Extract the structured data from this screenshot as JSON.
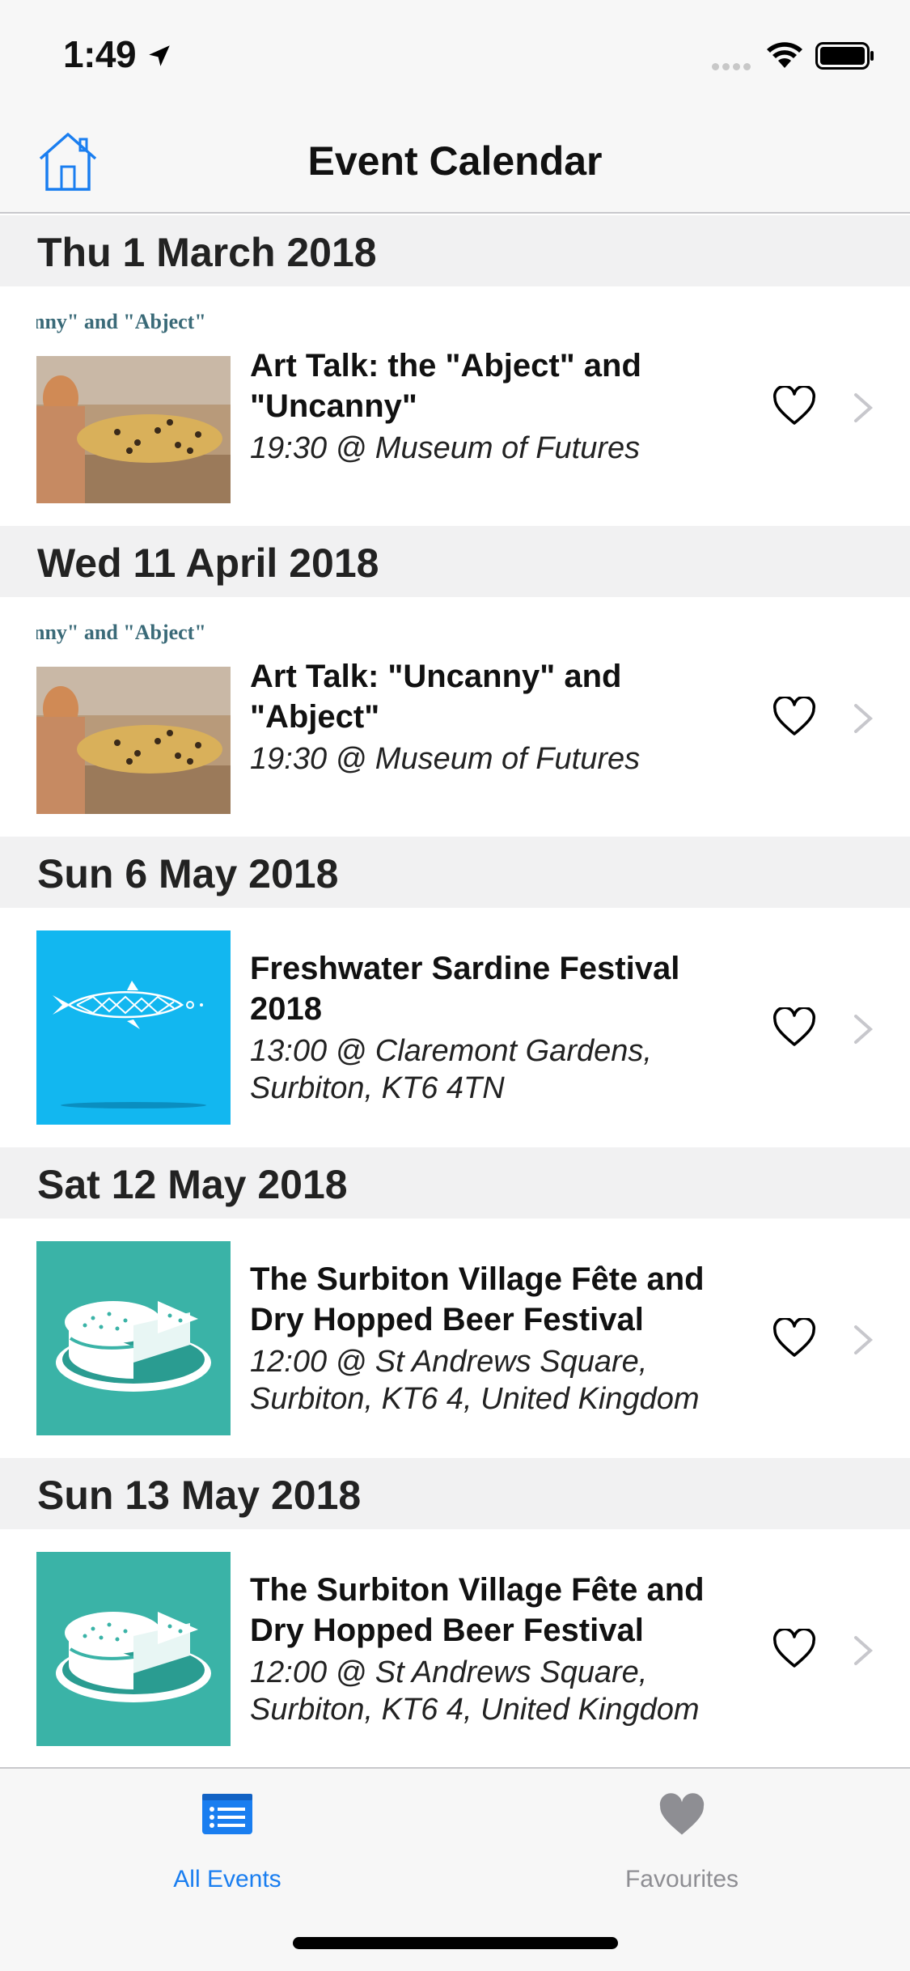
{
  "status": {
    "time": "1:49"
  },
  "nav": {
    "title": "Event Calendar"
  },
  "colors": {
    "accent": "#1a7ef0",
    "inactive": "#8e8e93",
    "teal": "#3ab3a7",
    "sky": "#12b7f0"
  },
  "sections": [
    {
      "date": "Thu 1 March 2018",
      "event": {
        "title": "Art Talk: the \"Abject\" and \"Uncanny\"",
        "subtitle": "19:30 @ Museum of Futures",
        "thumb_caption": "nny\" and \"Abject\"",
        "thumb": "art-talk-image"
      }
    },
    {
      "date": "Wed 11 April 2018",
      "event": {
        "title": "Art Talk: \"Uncanny\" and \"Abject\"",
        "subtitle": "19:30 @ Museum of Futures",
        "thumb_caption": "nny\" and \"Abject\"",
        "thumb": "art-talk-image"
      }
    },
    {
      "date": "Sun 6 May 2018",
      "event": {
        "title": "Freshwater Sardine Festival 2018",
        "subtitle": "13:00 @ Claremont Gardens, Surbiton, KT6 4TN",
        "thumb": "sardine-fish-icon"
      }
    },
    {
      "date": "Sat 12 May 2018",
      "event": {
        "title": "The Surbiton Village Fête and Dry Hopped Beer Festival",
        "subtitle": "12:00 @ St Andrews Square, Surbiton, KT6 4, United Kingdom",
        "thumb": "cake-icon"
      }
    },
    {
      "date": "Sun 13 May 2018",
      "event": {
        "title": "The Surbiton Village Fête and Dry Hopped Beer Festival",
        "subtitle": "12:00 @ St Andrews Square, Surbiton, KT6 4, United Kingdom",
        "thumb": "cake-icon"
      }
    }
  ],
  "tabs": [
    {
      "label": "All Events",
      "icon": "list-icon",
      "active": true
    },
    {
      "label": "Favourites",
      "icon": "heart-filled-icon",
      "active": false
    }
  ]
}
